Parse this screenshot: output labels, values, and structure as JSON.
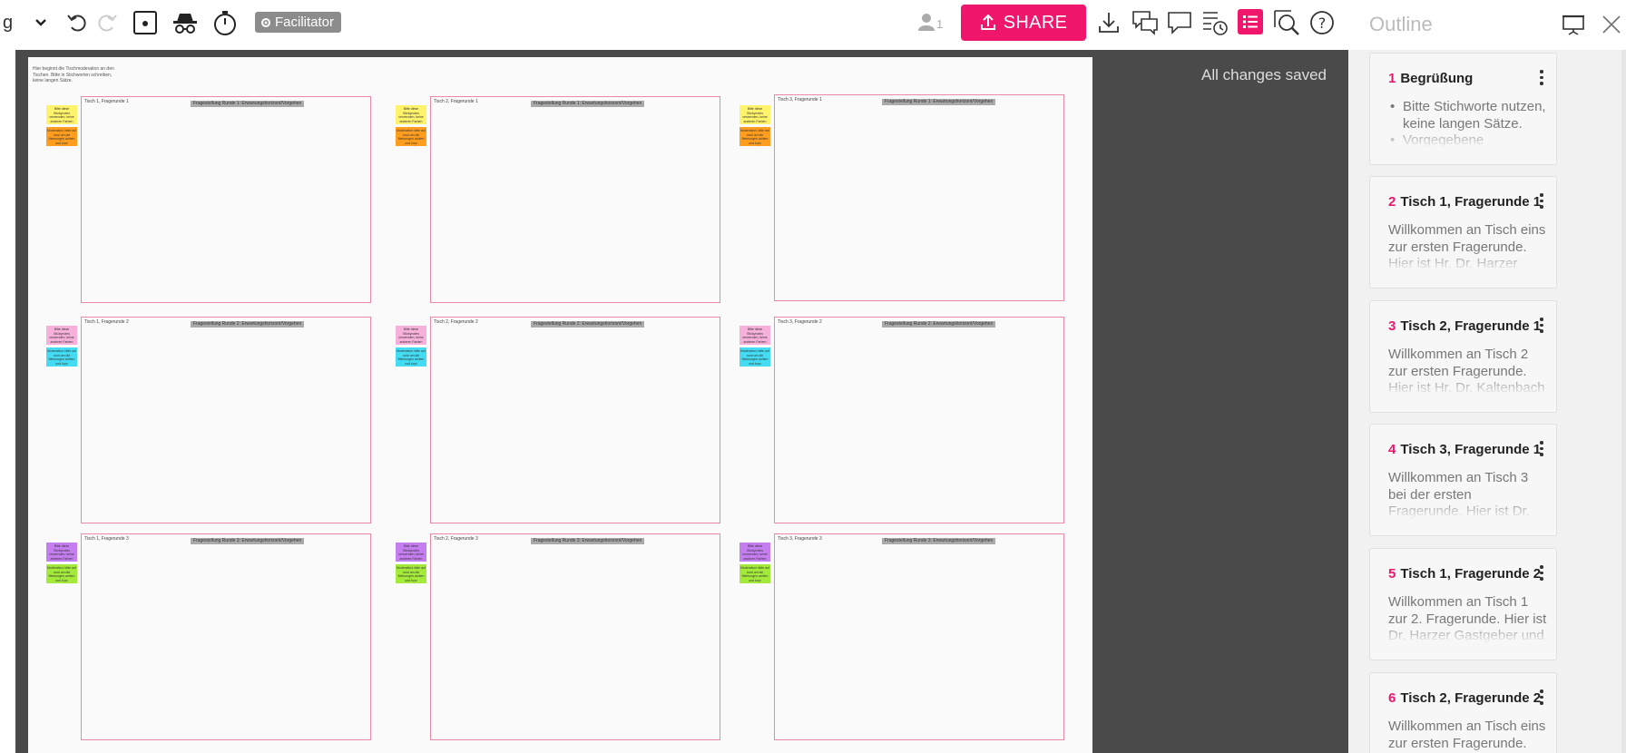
{
  "toolbar": {
    "dropdown_fragment": "g",
    "facilitator_label": "Facilitator",
    "user_count": "1",
    "share_label": "SHARE"
  },
  "status": {
    "saved_text": "All changes saved"
  },
  "board": {
    "intro_text": "Hier beginnt die Tischmoderation an den Tischen. Bitte in Stichworten schreiben, keine langen Sätze.",
    "frames": [
      {
        "title": "Tisch 1, Fragerunde 1",
        "label": "Fragestellung Runde 1: Erwartungshorizont/Vorgehen"
      },
      {
        "title": "Tisch 2, Fragerunde 1",
        "label": "Fragestellung Runde 1: Erwartungshorizont/Vorgehen"
      },
      {
        "title": "Tisch 3, Fragerunde 1",
        "label": "Fragestellung Runde 1: Erwartungshorizont/Vorgehen"
      },
      {
        "title": "Tisch 1, Fragerunde 2",
        "label": "Fragestellung Runde 2: Erwartungshorizont/Vorgehen"
      },
      {
        "title": "Tisch 2, Fragerunde 2",
        "label": "Fragestellung Runde 2: Erwartungshorizont/Vorgehen"
      },
      {
        "title": "Tisch 3, Fragerunde 2",
        "label": "Fragestellung Runde 2: Erwartungshorizont/Vorgehen"
      },
      {
        "title": "Tisch 1, Fragerunde 3",
        "label": "Fragestellung Runde 3: Erwartungshorizont/Vorgehen"
      },
      {
        "title": "Tisch 2, Fragerunde 3",
        "label": "Fragestellung Runde 3: Erwartungshorizont/Vorgehen"
      },
      {
        "title": "Tisch 3, Fragerunde 3",
        "label": "Fragestellung Runde 3: Erwartungshorizont/Vorgehen"
      }
    ],
    "sticky_top_text": "Bitte diese Stickynotes verwenden, keine anderen Farben",
    "sticky_bottom_text": "Moderation: bitte auf rund um die Meinungen achten und kurz zusammenfassen",
    "sticky_colors": {
      "yellow": "#fff36b",
      "orange": "#ff9d1e",
      "pink": "#f7b0d9",
      "cyan": "#43dcf3",
      "purple": "#c57ef0",
      "green": "#a3ea3a"
    }
  },
  "outline": {
    "title": "Outline",
    "cards": [
      {
        "num": "1",
        "title": "Begrüßung",
        "bullets": [
          "Bitte Stichworte nutzen, keine langen Sätze.",
          "Vorgegebene Stickynotes"
        ]
      },
      {
        "num": "2",
        "title": "Tisch 1, Fragerunde 1",
        "body": "Willkommen an Tisch eins zur ersten Fragerunde. Hier ist Hr. Dr. Harzer Gastgeber und"
      },
      {
        "num": "3",
        "title": "Tisch 2, Fragerunde 1",
        "body": "Willkommen an Tisch 2 zur ersten Fragerunde. Hier ist Hr. Dr. Kaltenbach Gastgeber und"
      },
      {
        "num": "4",
        "title": "Tisch 3, Fragerunde 1",
        "body": "Willkommen an Tisch 3 bei der ersten Fragerunde. Hier ist Dr. McKenna-Küttner der Gastgeber"
      },
      {
        "num": "5",
        "title": "Tisch 1, Fragerunde 2",
        "body": "Willkommen an Tisch 1 zur 2. Fragerunde. Hier ist Dr. Harzer Gastgeber und schreibt auf dem"
      },
      {
        "num": "6",
        "title": "Tisch 2, Fragerunde 2",
        "body": "Willkommen an Tisch eins zur ersten Fragerunde. Hier ist Hr."
      }
    ]
  },
  "icons": [
    "chevron-down-icon",
    "undo-icon",
    "redo-icon",
    "dice-icon",
    "incognito-icon",
    "timer-icon",
    "gear-icon",
    "user-icon",
    "upload-icon",
    "download-icon",
    "comments-icon",
    "chat-icon",
    "history-icon",
    "outline-icon",
    "zoom-icon",
    "help-icon",
    "presentation-icon",
    "close-icon"
  ]
}
